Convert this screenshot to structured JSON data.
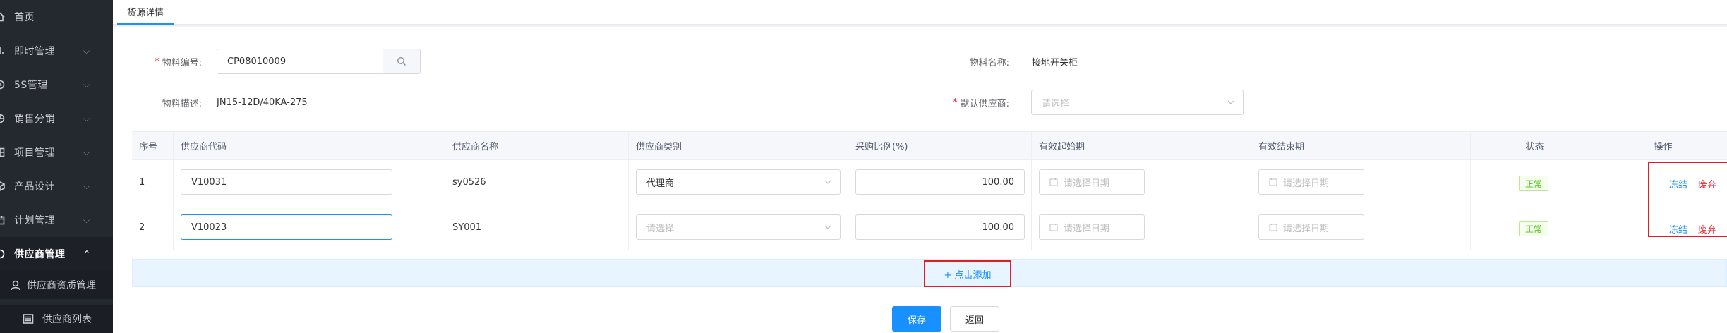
{
  "sidebar": {
    "items": [
      {
        "label": "首页",
        "icon": "home-icon",
        "expandable": false
      },
      {
        "label": "即时管理",
        "icon": "bar-chart-icon",
        "expandable": true
      },
      {
        "label": "5S管理",
        "icon": "clock-icon",
        "expandable": true
      },
      {
        "label": "销售分销",
        "icon": "pie-chart-icon",
        "expandable": true
      },
      {
        "label": "项目管理",
        "icon": "grid-icon",
        "expandable": true
      },
      {
        "label": "产品设计",
        "icon": "cube-icon",
        "expandable": true
      },
      {
        "label": "计划管理",
        "icon": "calendar-icon",
        "expandable": true
      },
      {
        "label": "供应商管理",
        "icon": "link-icon",
        "expandable": true,
        "open": true
      }
    ],
    "sub_items": [
      {
        "label": "供应商资质管理",
        "icon": "user-icon"
      },
      {
        "label": "供应商列表",
        "icon": "list-icon"
      }
    ]
  },
  "tabs": [
    {
      "label": "货源详情",
      "active": true
    }
  ],
  "form": {
    "material_code": {
      "label": "物料编号:",
      "value": "CP08010009",
      "required": true
    },
    "material_name": {
      "label": "物料名称:",
      "value": "接地开关柜"
    },
    "material_desc": {
      "label": "物料描述:",
      "value": "JN15-12D/40KA-275"
    },
    "default_supplier": {
      "label": "默认供应商:",
      "placeholder": "请选择",
      "required": true
    }
  },
  "table": {
    "columns": [
      "序号",
      "供应商代码",
      "供应商名称",
      "供应商类别",
      "采购比例(%)",
      "有效起始期",
      "有效结束期",
      "状态",
      "操作"
    ],
    "rows": [
      {
        "index": "1",
        "code": "V10031",
        "name": "sy0526",
        "category": "代理商",
        "category_placeholder": "",
        "ratio": "100.00",
        "start_placeholder": "请选择日期",
        "end_placeholder": "请选择日期",
        "status": "正常",
        "op_freeze": "冻结",
        "op_discard": "废弃",
        "focused": false
      },
      {
        "index": "2",
        "code": "V10023",
        "name": "SY001",
        "category": "",
        "category_placeholder": "请选择",
        "ratio": "100.00",
        "start_placeholder": "请选择日期",
        "end_placeholder": "请选择日期",
        "status": "正常",
        "op_freeze": "冻结",
        "op_discard": "废弃",
        "focused": true
      }
    ],
    "add_label": "+ 点击添加"
  },
  "actions": {
    "save_label": "保存",
    "back_label": "返回"
  },
  "colors": {
    "sidebar_bg": "#24282f",
    "primary": "#1890ff",
    "danger": "#f5222d",
    "success": "#52c41a"
  }
}
